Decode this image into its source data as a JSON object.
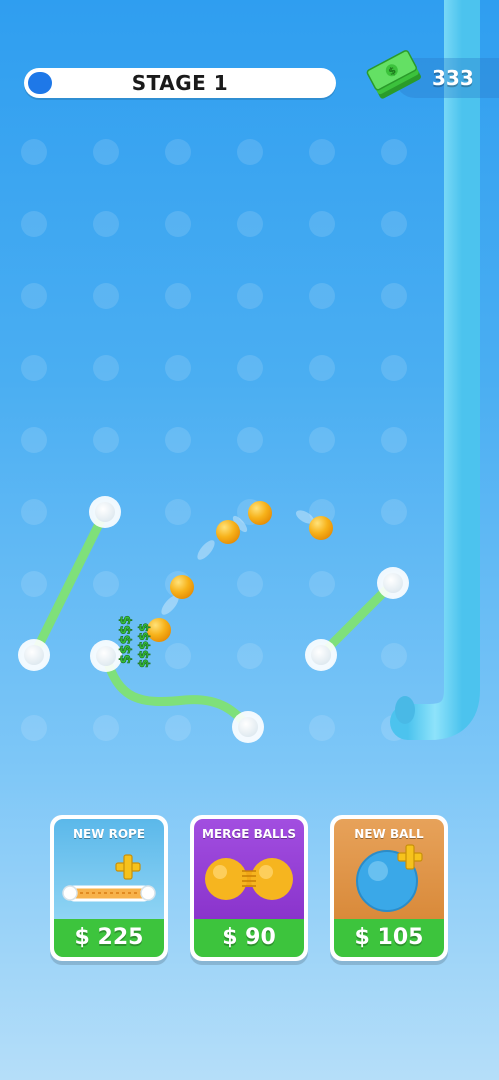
{
  "hud": {
    "stage_label": "STAGE 1",
    "stage_progress": 0.08,
    "cash_amount": "333",
    "cash_icon": "cash-stack-icon"
  },
  "shop": [
    {
      "title": "NEW ROPE",
      "price": "$ 225",
      "color": "#5bb8ea",
      "icon": "rope-plus-icon"
    },
    {
      "title": "MERGE BALLS",
      "price": "$ 90",
      "color": "#9b45d8",
      "icon": "merge-balls-icon"
    },
    {
      "title": "NEW BALL",
      "price": "$ 105",
      "color": "#e0994e",
      "icon": "ball-plus-icon"
    }
  ],
  "colors": {
    "rope": "#7fe07a",
    "ball": "#f7b21a",
    "peg": "#ffffff",
    "tube": "#5fd0f3",
    "price_green": "#3dc43d"
  },
  "floating_text": "$$$$$"
}
